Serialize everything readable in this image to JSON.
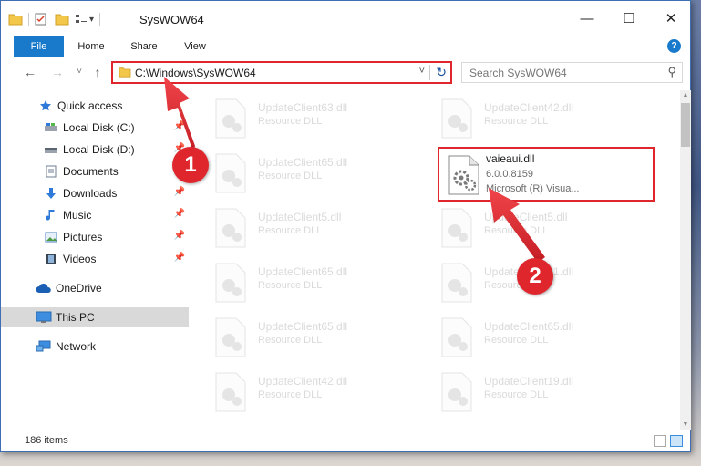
{
  "window": {
    "title": "SysWOW64",
    "qa_dropdown": "▾",
    "controls": {
      "minimize": "—",
      "maximize": "☐",
      "close": "✕"
    }
  },
  "ribbon": {
    "tabs": [
      "File",
      "Home",
      "Share",
      "View"
    ],
    "help": "?"
  },
  "navbar": {
    "back": "←",
    "forward": "→",
    "recent": "˅",
    "up": "↑",
    "address": "C:\\Windows\\SysWOW64",
    "address_dropdown": "˅",
    "refresh": "↻",
    "search_placeholder": "Search SysWOW64",
    "search_icon": "⚲"
  },
  "sidebar": {
    "items": [
      {
        "label": "Quick access",
        "icon": "star-icon"
      },
      {
        "label": "Local Disk (C:)",
        "icon": "drive-icon"
      },
      {
        "label": "Local Disk (D:)",
        "icon": "drive-icon"
      },
      {
        "label": "Documents",
        "icon": "documents-icon"
      },
      {
        "label": "Downloads",
        "icon": "download-icon"
      },
      {
        "label": "Music",
        "icon": "music-icon"
      },
      {
        "label": "Pictures",
        "icon": "pictures-icon"
      },
      {
        "label": "Videos",
        "icon": "videos-icon"
      },
      {
        "label": "OneDrive",
        "icon": "cloud-icon"
      },
      {
        "label": "This PC",
        "icon": "computer-icon"
      },
      {
        "label": "Network",
        "icon": "network-icon"
      }
    ],
    "pin": "📌"
  },
  "files": [
    {
      "name": "UpdateClient63.dll",
      "desc": "Resource DLL"
    },
    {
      "name": "UpdateClient42.dll",
      "desc": "Resource DLL"
    },
    {
      "name": "UpdateClient65.dll",
      "desc": "Resource DLL"
    },
    {
      "name": "vaieaui.dll",
      "version": "6.0.0.8159",
      "desc": "Microsoft (R) Visua..."
    },
    {
      "name": "UpdateClient5.dll",
      "desc": "Resource DLL"
    },
    {
      "name": "UpdateClient5.dll",
      "desc": "Resource DLL"
    },
    {
      "name": "UpdateClient65.dll",
      "desc": "Resource DLL"
    },
    {
      "name": "UpdateClient21.dll",
      "desc": "Resource DLL"
    },
    {
      "name": "UpdateClient65.dll",
      "desc": "Resource DLL"
    },
    {
      "name": "UpdateClient65.dll",
      "desc": "Resource DLL"
    },
    {
      "name": "UpdateClient42.dll",
      "desc": "Resource DLL"
    },
    {
      "name": "UpdateClient19.dll",
      "desc": "Resource DLL"
    }
  ],
  "status": {
    "item_count": "186 items"
  },
  "annotations": {
    "step1": "1",
    "step2": "2"
  },
  "colors": {
    "accent": "#1979ca",
    "annotation": "#e0262d"
  }
}
